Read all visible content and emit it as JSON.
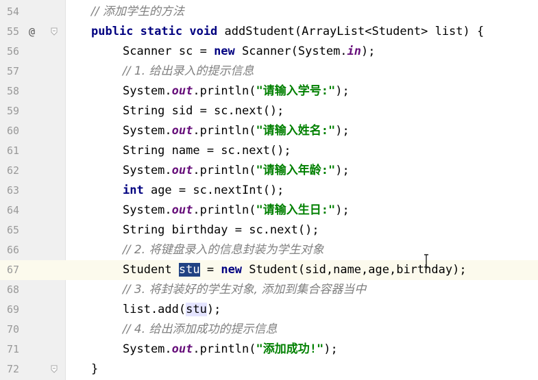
{
  "editor": {
    "lines": [
      {
        "num": "54",
        "marker": "",
        "fold": false,
        "current": false,
        "indent": 8,
        "tokens": [
          {
            "t": "cm",
            "v": "// 添加学生的方法"
          }
        ]
      },
      {
        "num": "55",
        "marker": "@",
        "fold": true,
        "current": false,
        "indent": 8,
        "tokens": [
          {
            "t": "kw",
            "v": "public"
          },
          {
            "t": "pl",
            "v": " "
          },
          {
            "t": "kw",
            "v": "static"
          },
          {
            "t": "pl",
            "v": " "
          },
          {
            "t": "kw",
            "v": "void"
          },
          {
            "t": "pl",
            "v": " addStudent(ArrayList<Student> list) {"
          }
        ]
      },
      {
        "num": "56",
        "marker": "",
        "fold": false,
        "current": false,
        "indent": 12,
        "tokens": [
          {
            "t": "pl",
            "v": "Scanner sc = "
          },
          {
            "t": "kw",
            "v": "new"
          },
          {
            "t": "pl",
            "v": " Scanner(System."
          },
          {
            "t": "fld",
            "v": "in"
          },
          {
            "t": "pl",
            "v": ");"
          }
        ]
      },
      {
        "num": "57",
        "marker": "",
        "fold": false,
        "current": false,
        "indent": 12,
        "tokens": [
          {
            "t": "cm",
            "v": "// 1. 给出录入的提示信息"
          }
        ]
      },
      {
        "num": "58",
        "marker": "",
        "fold": false,
        "current": false,
        "indent": 12,
        "tokens": [
          {
            "t": "pl",
            "v": "System."
          },
          {
            "t": "fld",
            "v": "out"
          },
          {
            "t": "pl",
            "v": ".println("
          },
          {
            "t": "st",
            "v": "\"请输入学号:\""
          },
          {
            "t": "pl",
            "v": ");"
          }
        ]
      },
      {
        "num": "59",
        "marker": "",
        "fold": false,
        "current": false,
        "indent": 12,
        "tokens": [
          {
            "t": "pl",
            "v": "String sid = sc.next();"
          }
        ]
      },
      {
        "num": "60",
        "marker": "",
        "fold": false,
        "current": false,
        "indent": 12,
        "tokens": [
          {
            "t": "pl",
            "v": "System."
          },
          {
            "t": "fld",
            "v": "out"
          },
          {
            "t": "pl",
            "v": ".println("
          },
          {
            "t": "st",
            "v": "\"请输入姓名:\""
          },
          {
            "t": "pl",
            "v": ");"
          }
        ]
      },
      {
        "num": "61",
        "marker": "",
        "fold": false,
        "current": false,
        "indent": 12,
        "tokens": [
          {
            "t": "pl",
            "v": "String name = sc.next();"
          }
        ]
      },
      {
        "num": "62",
        "marker": "",
        "fold": false,
        "current": false,
        "indent": 12,
        "tokens": [
          {
            "t": "pl",
            "v": "System."
          },
          {
            "t": "fld",
            "v": "out"
          },
          {
            "t": "pl",
            "v": ".println("
          },
          {
            "t": "st",
            "v": "\"请输入年龄:\""
          },
          {
            "t": "pl",
            "v": ");"
          }
        ]
      },
      {
        "num": "63",
        "marker": "",
        "fold": false,
        "current": false,
        "indent": 12,
        "tokens": [
          {
            "t": "kw",
            "v": "int"
          },
          {
            "t": "pl",
            "v": " age = sc.nextInt();"
          }
        ]
      },
      {
        "num": "64",
        "marker": "",
        "fold": false,
        "current": false,
        "indent": 12,
        "tokens": [
          {
            "t": "pl",
            "v": "System."
          },
          {
            "t": "fld",
            "v": "out"
          },
          {
            "t": "pl",
            "v": ".println("
          },
          {
            "t": "st",
            "v": "\"请输入生日:\""
          },
          {
            "t": "pl",
            "v": ");"
          }
        ]
      },
      {
        "num": "65",
        "marker": "",
        "fold": false,
        "current": false,
        "indent": 12,
        "tokens": [
          {
            "t": "pl",
            "v": "String birthday = sc.next();"
          }
        ]
      },
      {
        "num": "66",
        "marker": "",
        "fold": false,
        "current": false,
        "indent": 12,
        "tokens": [
          {
            "t": "cm",
            "v": "// 2. 将键盘录入的信息封装为学生对象"
          }
        ]
      },
      {
        "num": "67",
        "marker": "",
        "fold": false,
        "current": true,
        "indent": 12,
        "tokens": [
          {
            "t": "pl",
            "v": "Student "
          },
          {
            "t": "sel",
            "v": "stu"
          },
          {
            "t": "pl",
            "v": " = "
          },
          {
            "t": "kw",
            "v": "new"
          },
          {
            "t": "pl",
            "v": " Student(sid,name,age,birthday);"
          }
        ]
      },
      {
        "num": "68",
        "marker": "",
        "fold": false,
        "current": false,
        "indent": 12,
        "tokens": [
          {
            "t": "cm",
            "v": "// 3. 将封装好的学生对象, 添加到集合容器当中"
          }
        ]
      },
      {
        "num": "69",
        "marker": "",
        "fold": false,
        "current": false,
        "indent": 12,
        "tokens": [
          {
            "t": "pl",
            "v": "list.add("
          },
          {
            "t": "ident-hl",
            "v": "stu"
          },
          {
            "t": "pl",
            "v": ");"
          }
        ]
      },
      {
        "num": "70",
        "marker": "",
        "fold": false,
        "current": false,
        "indent": 12,
        "tokens": [
          {
            "t": "cm",
            "v": "// 4. 给出添加成功的提示信息"
          }
        ]
      },
      {
        "num": "71",
        "marker": "",
        "fold": false,
        "current": false,
        "indent": 12,
        "tokens": [
          {
            "t": "pl",
            "v": "System."
          },
          {
            "t": "fld",
            "v": "out"
          },
          {
            "t": "pl",
            "v": ".println("
          },
          {
            "t": "st",
            "v": "\"添加成功!\""
          },
          {
            "t": "pl",
            "v": ");"
          }
        ]
      },
      {
        "num": "72",
        "marker": "",
        "fold": true,
        "current": false,
        "indent": 8,
        "tokens": [
          {
            "t": "pl",
            "v": "}"
          }
        ]
      }
    ]
  },
  "colors": {
    "keyword": "#000080",
    "comment": "#808080",
    "string": "#008000",
    "field": "#660e7a",
    "selection": "#214283",
    "current_line": "#fcfaed",
    "gutter": "#f0f0f0"
  },
  "icons": {
    "override": "at-sign-override-icon",
    "fold": "fold-marker-icon",
    "cursor": "text-ibeam-cursor-icon"
  }
}
